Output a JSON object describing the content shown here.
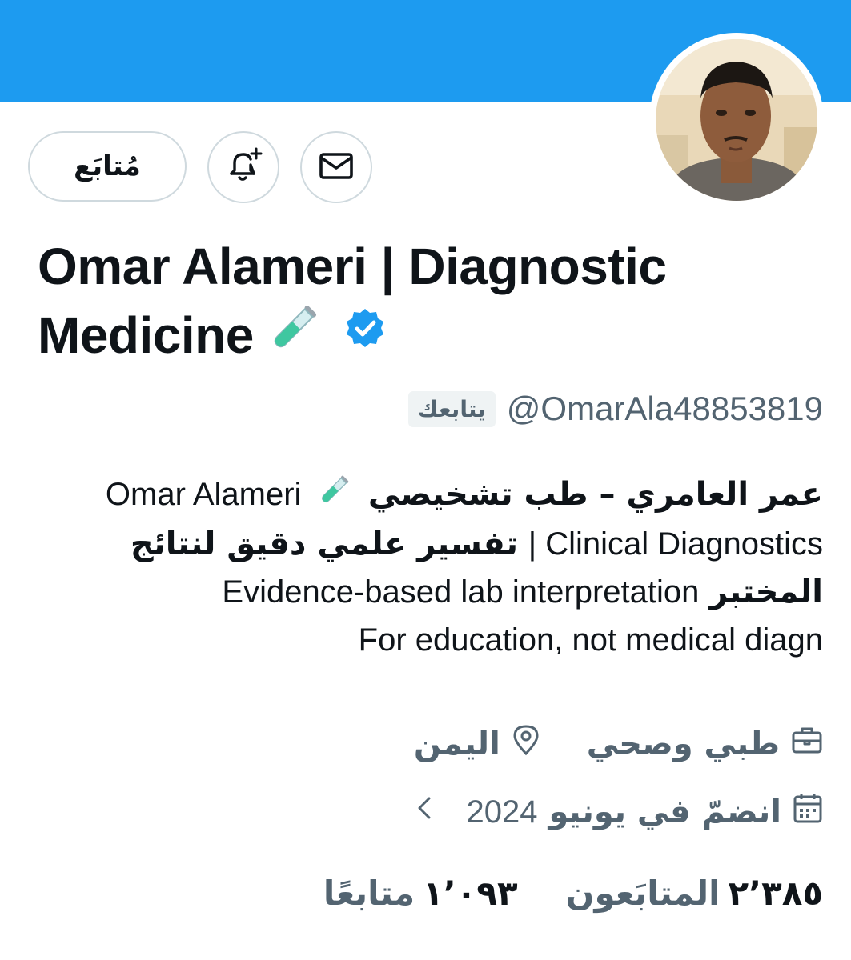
{
  "colors": {
    "banner": "#1d9bf0",
    "verified": "#1d9bf0",
    "text_primary": "#0f1419",
    "text_secondary": "#536471",
    "button_border": "#cfd9de"
  },
  "header": {
    "avatar_icon": "profile-photo",
    "follow_button_label": "مُتابَع",
    "notify_icon": "bell-plus-icon",
    "message_icon": "envelope-icon"
  },
  "profile": {
    "name_line1": "Omar Alameri | Diagnostic",
    "name_line2": "Medicine",
    "name_emoji": "test-tube-icon",
    "verified_icon": "verified-badge-icon",
    "follows_you": "يتابعك",
    "handle": "@OmarAla48853819"
  },
  "bio": {
    "l1_ar": "عمر العامري – طب تشخيصي",
    "l1_en": "Omar Alameri",
    "l2_en": "Clinical Diagnostics |",
    "l2_ar": "تفسير علمي دقيق لنتائج",
    "l3_ar": "المختبر",
    "l3_en": "Evidence-based lab interpretation",
    "l4_en": "For education, not medical diagn"
  },
  "meta": {
    "category": "طبي وصحي",
    "category_icon": "briefcase-icon",
    "location": "اليمن",
    "location_icon": "location-pin-icon",
    "joined_prefix": "انضمّ في يونيو",
    "joined_year": "2024",
    "calendar_icon": "calendar-icon",
    "chevron_icon": "chevron-left-icon"
  },
  "stats": {
    "followers_count": "٢٬٣٨٥",
    "followers_label": "المتابَعون",
    "following_count": "١٬٠٩٣",
    "following_label": "متابعًا"
  }
}
